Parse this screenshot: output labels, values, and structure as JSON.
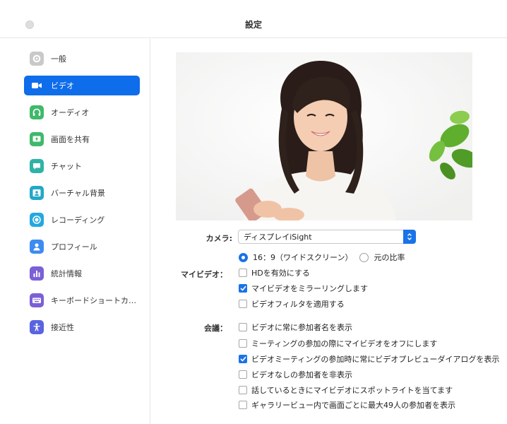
{
  "window": {
    "title": "設定"
  },
  "sidebar": {
    "items": [
      {
        "label": "一般",
        "icon": "gear-icon",
        "color": "#bdbdbd"
      },
      {
        "label": "ビデオ",
        "icon": "video-camera-icon",
        "color": "#0e6dea",
        "selected": true
      },
      {
        "label": "オーディオ",
        "icon": "headphones-icon",
        "color": "#3fb96a"
      },
      {
        "label": "画面を共有",
        "icon": "share-screen-icon",
        "color": "#3fb96a"
      },
      {
        "label": "チャット",
        "icon": "chat-bubble-icon",
        "color": "#2fb3a6"
      },
      {
        "label": "バーチャル背景",
        "icon": "virtual-background-icon",
        "color": "#23a8c7"
      },
      {
        "label": "レコーディング",
        "icon": "record-icon",
        "color": "#23a8e0"
      },
      {
        "label": "プロフィール",
        "icon": "profile-icon",
        "color": "#3d8bf0"
      },
      {
        "label": "統計情報",
        "icon": "bar-chart-icon",
        "color": "#7b5fd6"
      },
      {
        "label": "キーボードショートカ…",
        "icon": "keyboard-icon",
        "color": "#7b5fd6"
      },
      {
        "label": "接近性",
        "icon": "accessibility-icon",
        "color": "#5a63e0"
      }
    ]
  },
  "video": {
    "camera_label": "カメラ:",
    "camera_value": "ディスプレイiSight",
    "my_video_label": "マイビデオ：",
    "meetings_label": "会議：",
    "aspect_options": [
      {
        "label": "16：9（ワイドスクリーン）",
        "selected": true
      },
      {
        "label": "元の比率",
        "selected": false
      }
    ],
    "my_video_options": [
      {
        "label": "HDを有効にする",
        "checked": false
      },
      {
        "label": "マイビデオをミラーリングします",
        "checked": true
      },
      {
        "label": "ビデオフィルタを適用する",
        "checked": false
      }
    ],
    "meeting_options": [
      {
        "label": "ビデオに常に参加者名を表示",
        "checked": false
      },
      {
        "label": "ミーティングの参加の際にマイビデオをオフにします",
        "checked": false
      },
      {
        "label": "ビデオミーティングの参加時に常にビデオプレビューダイアログを表示",
        "checked": true
      },
      {
        "label": "ビデオなしの参加者を非表示",
        "checked": false
      },
      {
        "label": "話しているときにマイビデオにスポットライトを当てます",
        "checked": false
      },
      {
        "label": "ギャラリービュー内で画面ごとに最大49人の参加者を表示",
        "checked": false
      }
    ]
  }
}
